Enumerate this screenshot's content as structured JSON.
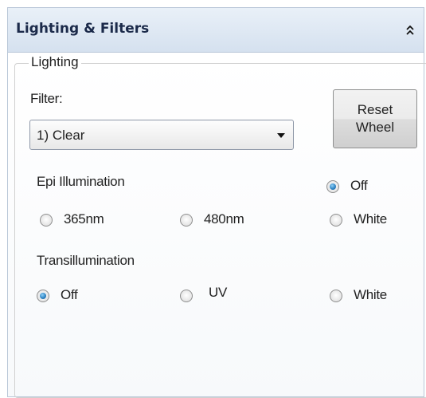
{
  "panel": {
    "title": "Lighting & Filters",
    "collapse_icon": "double-chevron-up-icon"
  },
  "lighting": {
    "group_title": "Lighting",
    "filter_label": "Filter:",
    "filter_value": "1) Clear",
    "reset_button_label": "Reset\nWheel",
    "epi": {
      "label": "Epi Illumination",
      "options": [
        {
          "label": "Off",
          "checked": true
        },
        {
          "label": "365nm",
          "checked": false
        },
        {
          "label": "480nm",
          "checked": false
        },
        {
          "label": "White",
          "checked": false
        }
      ]
    },
    "trans": {
      "label": "Transillumination",
      "options": [
        {
          "label": "Off",
          "checked": true
        },
        {
          "label": "UV",
          "checked": false
        },
        {
          "label": "White",
          "checked": false
        }
      ]
    }
  }
}
